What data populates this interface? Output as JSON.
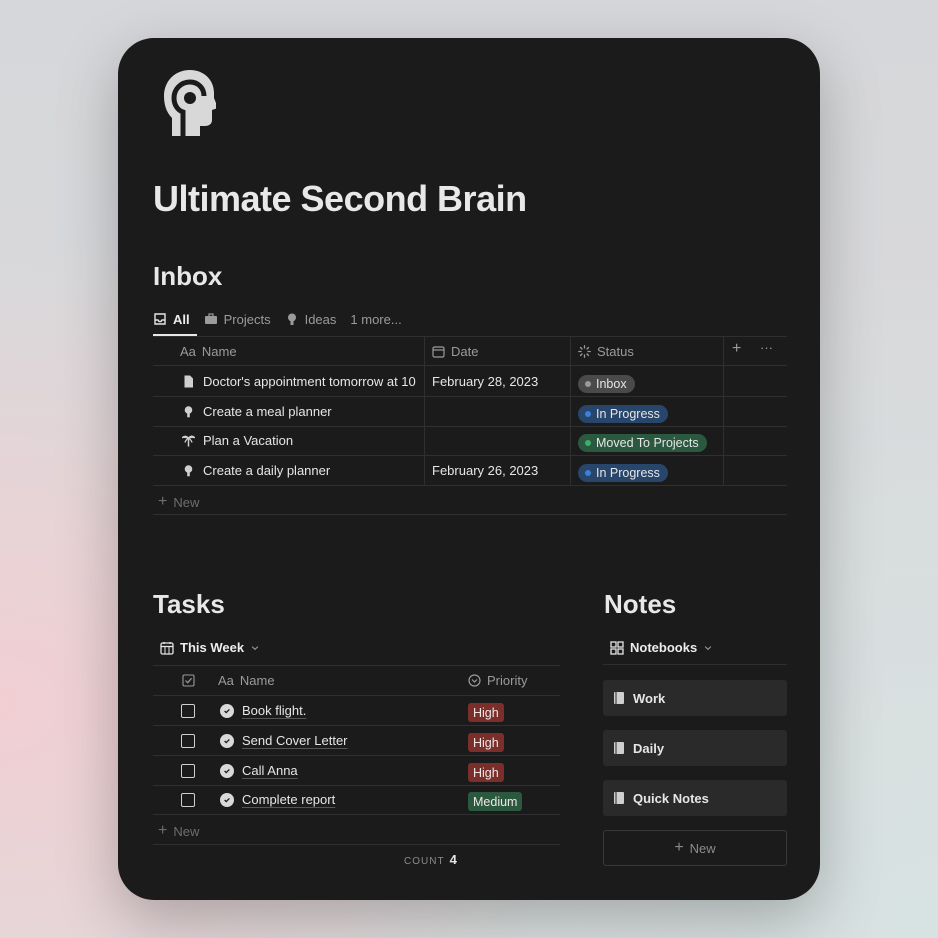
{
  "page": {
    "title": "Ultimate Second Brain",
    "logo_icon": "brain-head-icon"
  },
  "inbox": {
    "title": "Inbox",
    "tabs": [
      {
        "label": "All",
        "icon": "inbox-tray-icon",
        "active": true
      },
      {
        "label": "Projects",
        "icon": "briefcase-icon",
        "active": false
      },
      {
        "label": "Ideas",
        "icon": "lightbulb-icon",
        "active": false
      },
      {
        "label": "1 more...",
        "active": false
      }
    ],
    "columns": {
      "name": "Name",
      "name_prefix": "Aa",
      "date": "Date",
      "status": "Status"
    },
    "rows": [
      {
        "icon": "document-icon",
        "name": "Doctor's appointment tomorrow at 10",
        "date": "February 28, 2023",
        "status": "Inbox",
        "status_color": "#4a4a4a",
        "dot_color": "#9b9b9b"
      },
      {
        "icon": "lightbulb-icon",
        "name": "Create a meal planner",
        "date": "",
        "status": "In Progress",
        "status_color": "#28456c",
        "dot_color": "#3b82d6"
      },
      {
        "icon": "palm-tree-icon",
        "name": "Plan a Vacation",
        "date": "",
        "status": "Moved To Projects",
        "status_color": "#2b593f",
        "dot_color": "#3fae6b"
      },
      {
        "icon": "lightbulb-icon",
        "name": "Create a daily planner",
        "date": "February 26, 2023",
        "status": "In Progress",
        "status_color": "#28456c",
        "dot_color": "#3b82d6"
      }
    ],
    "new_label": "New",
    "add_column": "+",
    "more": "···"
  },
  "tasks": {
    "title": "Tasks",
    "view": "This Week",
    "columns": {
      "name_prefix": "Aa",
      "name": "Name",
      "priority": "Priority"
    },
    "rows": [
      {
        "name": "Book flight.",
        "priority": "High",
        "priority_color": "#7a2f2b"
      },
      {
        "name": "Send Cover Letter",
        "priority": "High",
        "priority_color": "#7a2f2b"
      },
      {
        "name": "Call Anna",
        "priority": "High",
        "priority_color": "#7a2f2b"
      },
      {
        "name": "Complete report",
        "priority": "Medium",
        "priority_color": "#2b593f"
      }
    ],
    "new_label": "New",
    "count_label": "COUNT",
    "count_value": "4"
  },
  "notes": {
    "title": "Notes",
    "view": "Notebooks",
    "notebooks": [
      "Work",
      "Daily",
      "Quick Notes"
    ],
    "new_label": "New"
  }
}
